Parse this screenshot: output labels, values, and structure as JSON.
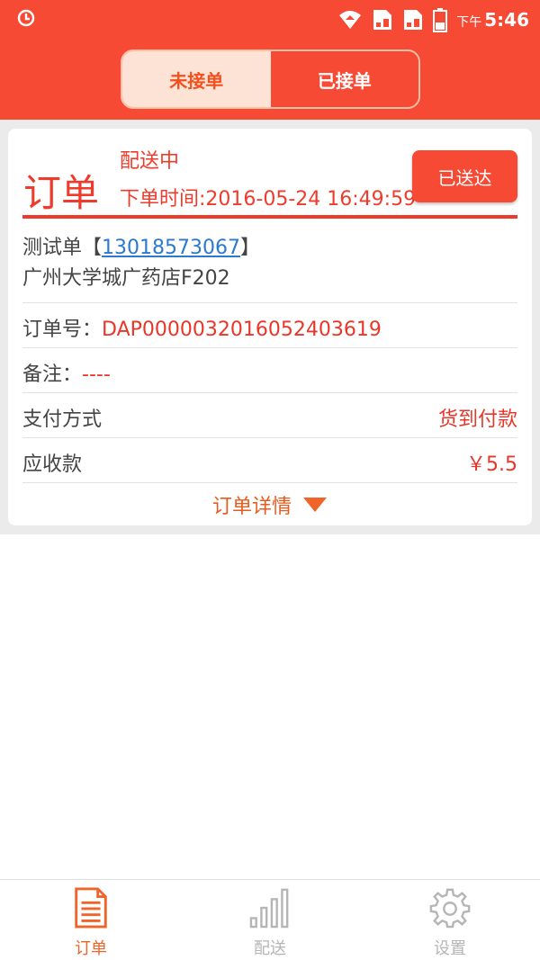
{
  "status_bar": {
    "period": "下午",
    "time": "5:46"
  },
  "segmented": {
    "pending_label": "未接单",
    "accepted_label": "已接单",
    "selected": "accepted"
  },
  "order_card": {
    "big_title": "订单",
    "status": "配送中",
    "order_time": "下单时间:2016-05-24 16:49:59",
    "delivered_button": "已送达",
    "customer_name": "测试单",
    "bracket_open": "【",
    "phone": "13018573067",
    "bracket_close": "】",
    "address": "广州大学城广药店F202",
    "order_no_label": "订单号：",
    "order_no": "DAP00000320160524036​19",
    "note_label": "备注：",
    "note_value": "----",
    "payment_label": "支付方式",
    "payment_value": "货到付款",
    "amount_label": "应收款",
    "amount_value": "￥5.5",
    "detail_link": "订单详情"
  },
  "tabbar": {
    "items": [
      {
        "label": "订单",
        "icon": "document-icon",
        "active": true
      },
      {
        "label": "配送",
        "icon": "bar-chart-icon",
        "active": false
      },
      {
        "label": "设置",
        "icon": "gear-icon",
        "active": false
      }
    ]
  },
  "colors": {
    "brand_red": "#f64a35",
    "text_red": "#ef3b2b",
    "link_blue": "#2b79d0",
    "tab_active": "#f0642a",
    "tab_inactive": "#b5b5b5"
  }
}
